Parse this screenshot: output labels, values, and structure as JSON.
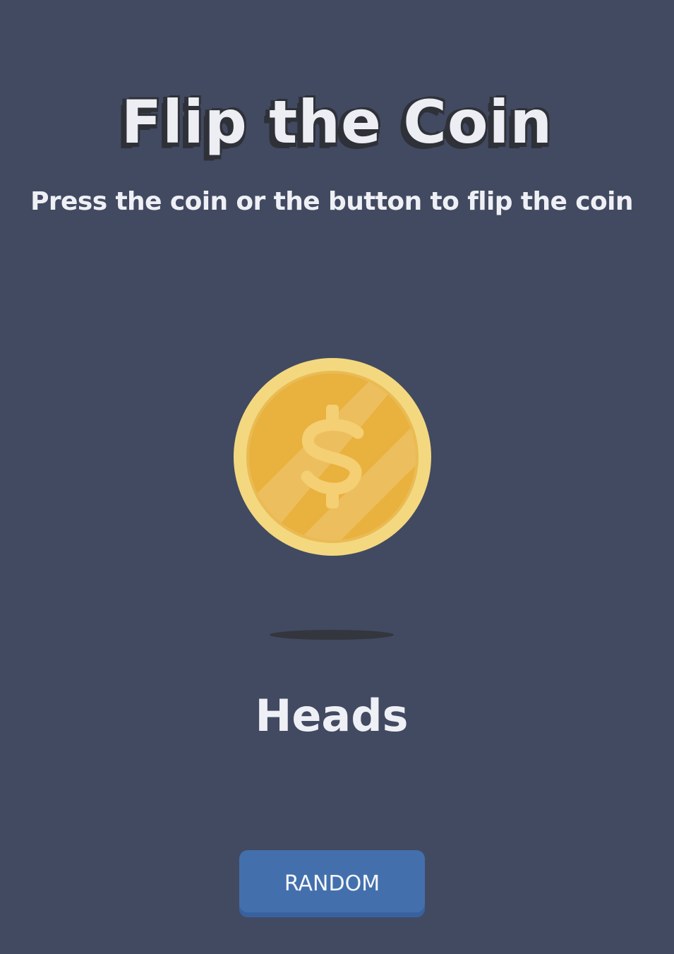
{
  "header": {
    "title": "Flip the Coin",
    "instruction": "Press the coin or the button to flip the coin"
  },
  "coin": {
    "face_symbol": "$",
    "icon": "dollar-coin-icon",
    "colors": {
      "outer_rim": "#f3d87f",
      "inner_face": "#e9b13d",
      "symbol": "#f4cf73",
      "shadow": "#33363d"
    }
  },
  "result": {
    "label": "Heads"
  },
  "controls": {
    "random_label": "RANDOM"
  },
  "theme": {
    "background": "#424a61",
    "text": "#eef0f5",
    "button": "#4370ad"
  }
}
